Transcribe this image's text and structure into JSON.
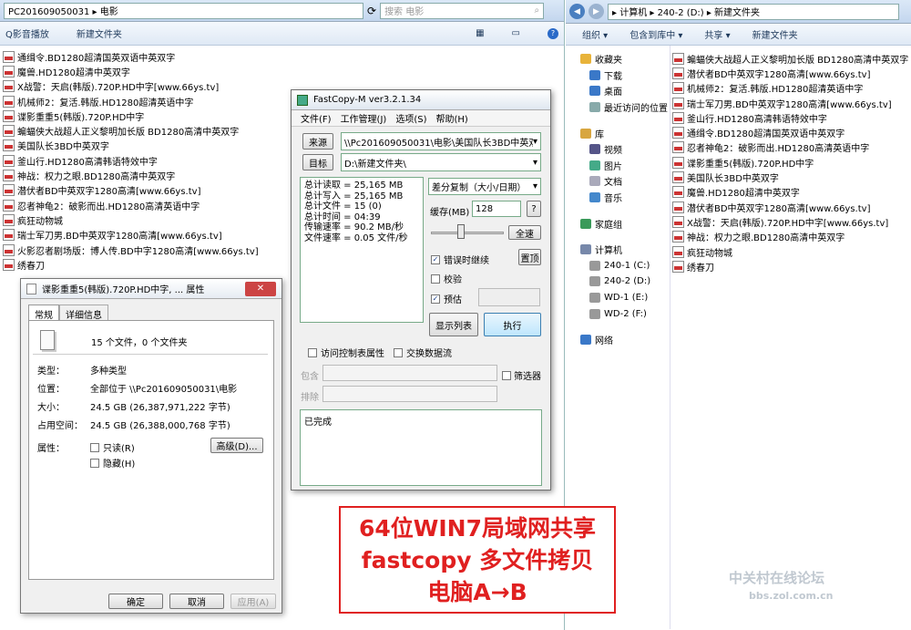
{
  "left_explorer": {
    "address": "PC201609050031 ▸ 电影",
    "search_placeholder": "搜索 电影",
    "toolbar": [
      "Q影音播放",
      "新建文件夹"
    ],
    "files": [
      "通缉令.BD1280超清国英双语中英双字",
      "魔兽.HD1280超清中英双字",
      "X战警：天启(韩版).720P.HD中字[www.66ys.tv]",
      "机械师2：复活.韩版.HD1280超清英语中字",
      "谍影重重5(韩版).720P.HD中字",
      "蝙蝠侠大战超人正义黎明加长版 BD1280高清中英双字",
      "美国队长3BD中英双字",
      "釜山行.HD1280高清韩语特效中字",
      "神战：权力之眼.BD1280高清中英双字",
      "潜伏者BD中英双字1280高清[www.66ys.tv]",
      "忍者神龟2：破影而出.HD1280高清英语中字",
      "疯狂动物城",
      "瑞士军刀男.BD中英双字1280高清[www.66ys.tv]",
      "火影忍者剧场版：博人传.BD中字1280高清[www.66ys.tv]",
      "绣春刀"
    ]
  },
  "right_explorer": {
    "address": "▸ 计算机 ▸ 240-2 (D:) ▸ 新建文件夹",
    "toolbar": [
      "组织 ▾",
      "包含到库中 ▾",
      "共享 ▾",
      "新建文件夹"
    ],
    "nav": [
      {
        "label": "收藏夹",
        "color": "#e8b33a"
      },
      {
        "label": "下载",
        "color": "#3a78c8"
      },
      {
        "label": "桌面",
        "color": "#3a78c8"
      },
      {
        "label": "最近访问的位置",
        "color": "#8aa"
      },
      {
        "label": "",
        "color": ""
      },
      {
        "label": "库",
        "color": "#d8a640"
      },
      {
        "label": "视频",
        "color": "#558"
      },
      {
        "label": "图片",
        "color": "#4a8"
      },
      {
        "label": "文档",
        "color": "#aab"
      },
      {
        "label": "音乐",
        "color": "#48c"
      },
      {
        "label": "",
        "color": ""
      },
      {
        "label": "家庭组",
        "color": "#3a9a5a"
      },
      {
        "label": "",
        "color": ""
      },
      {
        "label": "计算机",
        "color": "#78a"
      },
      {
        "label": "240-1 (C:)",
        "color": "#999"
      },
      {
        "label": "240-2 (D:)",
        "color": "#999"
      },
      {
        "label": "WD-1 (E:)",
        "color": "#999"
      },
      {
        "label": "WD-2 (F:)",
        "color": "#999"
      },
      {
        "label": "",
        "color": ""
      },
      {
        "label": "网络",
        "color": "#3a78c8"
      }
    ],
    "files": [
      "蝙蝠侠大战超人正义黎明加长版 BD1280高清中英双字",
      "潜伏者BD中英双字1280高清[www.66ys.tv]",
      "机械师2：复活.韩版.HD1280超清英语中字",
      "瑞士军刀男.BD中英双字1280高清[www.66ys.tv]",
      "釜山行.HD1280高清韩语特效中字",
      "通缉令.BD1280超清国英双语中英双字",
      "忍者神龟2：破影而出.HD1280高清英语中字",
      "谍影重重5(韩版).720P.HD中字",
      "美国队长3BD中英双字",
      "魔兽.HD1280超清中英双字",
      "潜伏者BD中英双字1280高清[www.66ys.tv]",
      "X战警：天启(韩版).720P.HD中字[www.66ys.tv]",
      "神战：权力之眼.BD1280高清中英双字",
      "疯狂动物城",
      "绣春刀"
    ]
  },
  "fastcopy": {
    "title": "FastCopy-M ver3.2.1.34",
    "menu": [
      "文件(F)",
      "工作管理(J)",
      "选项(S)",
      "帮助(H)"
    ],
    "src_btn": "来源",
    "src": "\\\\Pc201609050031\\电影\\美国队长3BD中英双字",
    "dst_btn": "目标",
    "dst": "D:\\新建文件夹\\",
    "stats": "总计读取 = 25,165 MB\n总计写入 = 25,165 MB\n总计文件 = 15 (0)\n总计时间 = 04:39\n传输速率 = 90.2 MB/秒\n文件速率 = 0.05 文件/秒",
    "mode": "差分复制（大小/日期）",
    "buf_label": "缓存(MB)",
    "buf_value": "128",
    "help": "?",
    "fullspeed": "全速",
    "opt_continue": "错误时继续",
    "opt_verify": "校验",
    "opt_estimate": "预估",
    "top_btn": "置顶",
    "list_btn": "显示列表",
    "exec_btn": "执行",
    "acl": "访问控制表属性",
    "streams": "交换数据流",
    "include": "包含",
    "exclude": "排除",
    "filter": "筛选器",
    "status": "已完成"
  },
  "props": {
    "title": "谍影重重5(韩版).720P.HD中字, ... 属性",
    "tabs": [
      "常规",
      "详细信息"
    ],
    "summary": "15 个文件，0 个文件夹",
    "rows": [
      [
        "类型：",
        "多种类型"
      ],
      [
        "位置：",
        "全部位于 \\\\Pc201609050031\\电影"
      ],
      [
        "大小：",
        "24.5 GB (26,387,971,222 字节)"
      ],
      [
        "占用空间：",
        "24.5 GB (26,388,000,768 字节)"
      ]
    ],
    "attr_label": "属性：",
    "readonly": "只读(R)",
    "hidden": "隐藏(H)",
    "advanced": "高级(D)...",
    "ok": "确定",
    "cancel": "取消",
    "apply": "应用(A)"
  },
  "banner": [
    "64位WIN7局域网共享",
    "fastcopy 多文件拷贝",
    "电脑A→B"
  ],
  "watermark": [
    "中关村在线论坛",
    "bbs.zol.com.cn"
  ]
}
